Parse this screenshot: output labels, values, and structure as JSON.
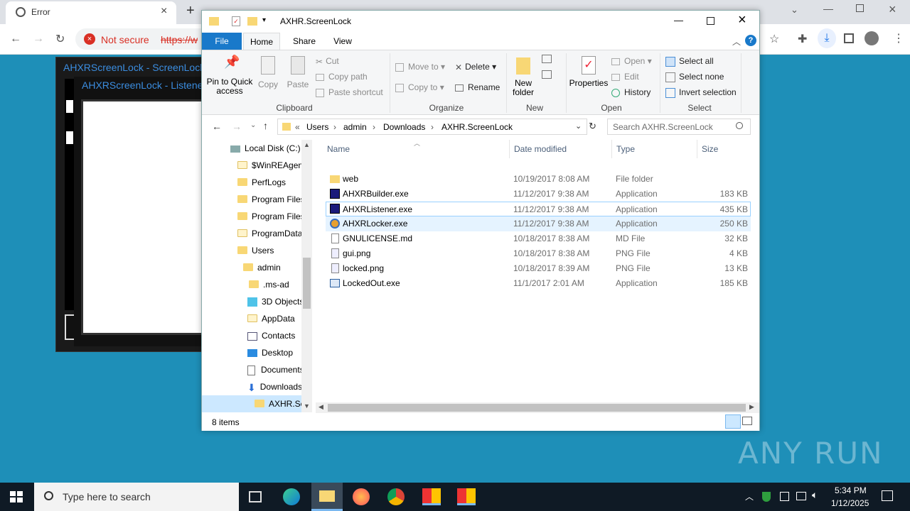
{
  "chrome": {
    "tab_title": "Error",
    "security_label": "Not secure",
    "url_fragment": "https://w"
  },
  "bg_windows": {
    "title1": "AHXRScreenLock - ScreenLock",
    "title2": "AHXRScreenLock - Listener"
  },
  "explorer": {
    "title": "AXHR.ScreenLock",
    "ribbon_tabs": [
      "File",
      "Home",
      "Share",
      "View"
    ],
    "ribbon": {
      "pin_label": "Pin to Quick access",
      "copy_label": "Copy",
      "paste_label": "Paste",
      "cut_label": "Cut",
      "copy_path_label": "Copy path",
      "paste_shortcut_label": "Paste shortcut",
      "clipboard_group": "Clipboard",
      "move_to_label": "Move to",
      "copy_to_label": "Copy to",
      "delete_label": "Delete",
      "rename_label": "Rename",
      "organize_group": "Organize",
      "new_folder_label": "New folder",
      "new_group": "New",
      "properties_label": "Properties",
      "open_label": "Open",
      "edit_label": "Edit",
      "history_label": "History",
      "open_group": "Open",
      "select_all_label": "Select all",
      "select_none_label": "Select none",
      "invert_selection_label": "Invert selection",
      "select_group": "Select"
    },
    "address": {
      "crumbs": [
        "Users",
        "admin",
        "Downloads",
        "AXHR.ScreenLock"
      ],
      "search_placeholder": "Search AXHR.ScreenLock"
    },
    "nav": [
      {
        "label": "Local Disk (C:)"
      },
      {
        "label": "$WinREAgent"
      },
      {
        "label": "PerfLogs"
      },
      {
        "label": "Program Files"
      },
      {
        "label": "Program Files"
      },
      {
        "label": "ProgramData"
      },
      {
        "label": "Users"
      },
      {
        "label": "admin"
      },
      {
        "label": ".ms-ad"
      },
      {
        "label": "3D Objects"
      },
      {
        "label": "AppData"
      },
      {
        "label": "Contacts"
      },
      {
        "label": "Desktop"
      },
      {
        "label": "Documents"
      },
      {
        "label": "Downloads"
      },
      {
        "label": "AXHR.ScreenLock"
      }
    ],
    "columns": {
      "name": "Name",
      "date": "Date modified",
      "type": "Type",
      "size": "Size"
    },
    "files": [
      {
        "name": "web",
        "date": "10/19/2017 8:08 AM",
        "type": "File folder",
        "size": ""
      },
      {
        "name": "AHXRBuilder.exe",
        "date": "11/12/2017 9:38 AM",
        "type": "Application",
        "size": "183 KB"
      },
      {
        "name": "AHXRListener.exe",
        "date": "11/12/2017 9:38 AM",
        "type": "Application",
        "size": "435 KB"
      },
      {
        "name": "AHXRLocker.exe",
        "date": "11/12/2017 9:38 AM",
        "type": "Application",
        "size": "250 KB"
      },
      {
        "name": "GNULICENSE.md",
        "date": "10/18/2017 8:38 AM",
        "type": "MD File",
        "size": "32 KB"
      },
      {
        "name": "gui.png",
        "date": "10/18/2017 8:38 AM",
        "type": "PNG File",
        "size": "4 KB"
      },
      {
        "name": "locked.png",
        "date": "10/18/2017 8:39 AM",
        "type": "PNG File",
        "size": "13 KB"
      },
      {
        "name": "LockedOut.exe",
        "date": "11/1/2017 2:01 AM",
        "type": "Application",
        "size": "185 KB"
      }
    ],
    "status": "8 items"
  },
  "taskbar": {
    "search_placeholder": "Type here to search",
    "time": "5:34 PM",
    "date": "1/12/2025"
  },
  "watermark": "ANY RUN"
}
